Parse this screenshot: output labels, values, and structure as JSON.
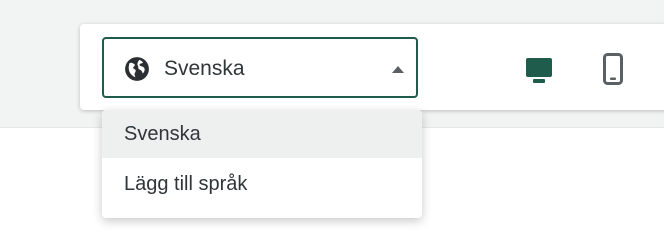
{
  "language_selector": {
    "selected": "Svenska",
    "icon": "globe-icon",
    "expanded": true,
    "options": [
      {
        "label": "Svenska",
        "selected": true
      },
      {
        "label": "Lägg till språk",
        "selected": false
      }
    ]
  },
  "device_preview": {
    "desktop_icon": "desktop-icon",
    "mobile_icon": "mobile-icon",
    "active": "desktop"
  },
  "colors": {
    "accent": "#1f5c4c",
    "text": "#303538",
    "icon_inactive": "#5b6065",
    "background": "#f2f3f3",
    "option_highlight": "#eef0f0"
  }
}
